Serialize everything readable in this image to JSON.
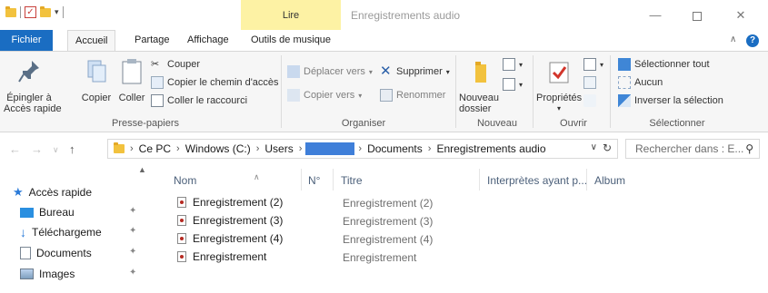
{
  "title_bar": {
    "contextual_tab_group": "Lire",
    "window_title": "Enregistrements audio"
  },
  "tabs": {
    "file": "Fichier",
    "home": "Accueil",
    "share": "Partage",
    "view": "Affichage",
    "music_tools": "Outils de musique"
  },
  "ribbon": {
    "clipboard": {
      "pin_quick_access": "Épingler à\nAccès rapide",
      "copy": "Copier",
      "paste": "Coller",
      "cut": "Couper",
      "copy_path": "Copier le chemin d'accès",
      "paste_shortcut": "Coller le raccourci",
      "group_label": "Presse-papiers"
    },
    "organize": {
      "move_to": "Déplacer vers",
      "copy_to": "Copier vers",
      "delete": "Supprimer",
      "rename": "Renommer",
      "group_label": "Organiser"
    },
    "new": {
      "new_folder": "Nouveau\ndossier",
      "group_label": "Nouveau"
    },
    "open": {
      "properties": "Propriétés",
      "group_label": "Ouvrir"
    },
    "select": {
      "select_all": "Sélectionner tout",
      "select_none": "Aucun",
      "invert_selection": "Inverser la sélection",
      "group_label": "Sélectionner"
    }
  },
  "address_bar": {
    "crumbs": [
      "Ce PC",
      "Windows (C:)",
      "Users",
      "Documents",
      "Enregistrements audio"
    ],
    "search_placeholder": "Rechercher dans : E..."
  },
  "nav_pane": {
    "items": [
      {
        "label": "Accès rapide",
        "icon": "star-icon"
      },
      {
        "label": "Bureau",
        "icon": "desktop-icon",
        "pinned": true
      },
      {
        "label": "Téléchargeme",
        "icon": "download-icon",
        "pinned": true
      },
      {
        "label": "Documents",
        "icon": "documents-icon",
        "pinned": true
      },
      {
        "label": "Images",
        "icon": "images-icon",
        "pinned": true
      }
    ]
  },
  "file_list": {
    "columns": [
      "Nom",
      "N°",
      "Titre",
      "Interprètes ayant p...",
      "Album"
    ],
    "rows": [
      {
        "name": "Enregistrement (2)",
        "title": "Enregistrement (2)"
      },
      {
        "name": "Enregistrement (3)",
        "title": "Enregistrement (3)"
      },
      {
        "name": "Enregistrement (4)",
        "title": "Enregistrement (4)"
      },
      {
        "name": "Enregistrement",
        "title": "Enregistrement"
      }
    ]
  },
  "colors": {
    "accent": "#1a6dc2",
    "contextual_band": "#fdf2a4",
    "ribbon_bg": "#f6f6f6",
    "redaction": "#3f7fd9"
  }
}
